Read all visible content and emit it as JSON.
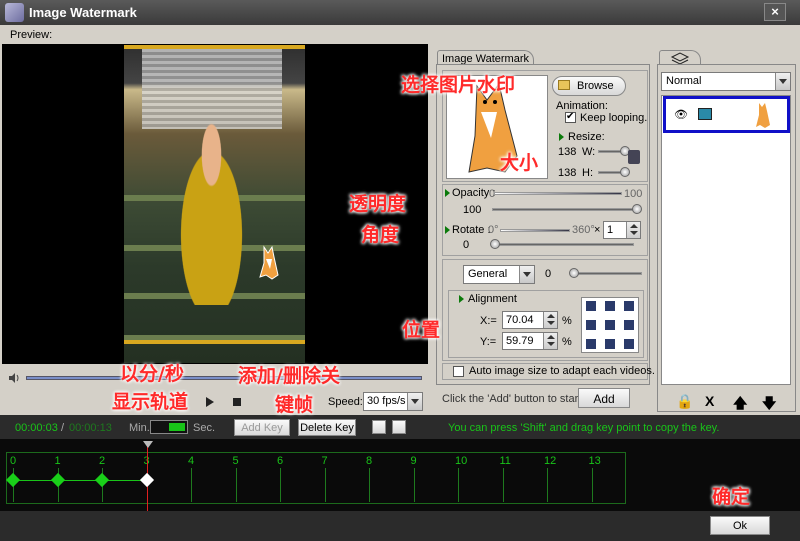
{
  "window": {
    "title": "Image Watermark",
    "close_icon": "×"
  },
  "preview": {
    "label": "Preview:"
  },
  "playback": {
    "speed_label": "Speed:",
    "speed_value": "30 fps/s"
  },
  "tab": {
    "label": "Image Watermark"
  },
  "watermark": {
    "browse_label": "Browse",
    "animation_label": "Animation:",
    "keep_looping_label": "Keep looping.",
    "keep_looping_checked": true,
    "resize_label": "Resize:",
    "width_value": "138",
    "width_label": "W:",
    "height_value": "138",
    "height_label": "H:"
  },
  "opacity": {
    "label": "Opacity :",
    "min": "0",
    "max": "100",
    "value": "100"
  },
  "rotate": {
    "label": "Rotate :",
    "min": "0°",
    "max": "360°",
    "multiplier": "×",
    "value": "0",
    "count": "1"
  },
  "effect": {
    "select_value": "General",
    "value": "0"
  },
  "alignment": {
    "label": "Alignment",
    "x_label": "X:=",
    "x_value": "70.04",
    "y_label": "Y:=",
    "y_value": "59.79",
    "unit": "%"
  },
  "auto_size": {
    "label": "Auto image size to adapt each videos."
  },
  "add_hint": "Click the 'Add' button to start ->",
  "add_button": "Add",
  "layers": {
    "blend_mode": "Normal",
    "tools": [
      "🔒",
      "X",
      "🡅",
      "🡇"
    ]
  },
  "timeline": {
    "current_time": "00:00:03",
    "separator": "/",
    "total_time": "00:00:13",
    "min_label": "Min.",
    "sec_label": "Sec.",
    "add_key_label": "Add Key",
    "delete_key_label": "Delete Key",
    "hint": "You can press 'Shift' and drag key point to copy the key.",
    "ticks": [
      "0",
      "1",
      "2",
      "3",
      "4",
      "5",
      "6",
      "7",
      "8",
      "9",
      "10",
      "11",
      "12",
      "13"
    ],
    "keys": [
      0,
      1,
      2,
      3
    ],
    "selected_key": 3,
    "playhead": 3
  },
  "ok_button": "Ok",
  "annotations": {
    "select_image": "选择图片水印",
    "size": "大小",
    "opacity": "透明度",
    "angle": "角度",
    "position": "位置",
    "min_sec": "以分/秒",
    "show_track": "显示轨道",
    "add_delete": "添加/删除关",
    "keyframe": "键帧",
    "confirm": "确定"
  },
  "colors": {
    "accent_green": "#19c419",
    "key_green": "#19d019",
    "selection_blue": "#1010c8",
    "annotation_red": "#ff2a2a"
  }
}
